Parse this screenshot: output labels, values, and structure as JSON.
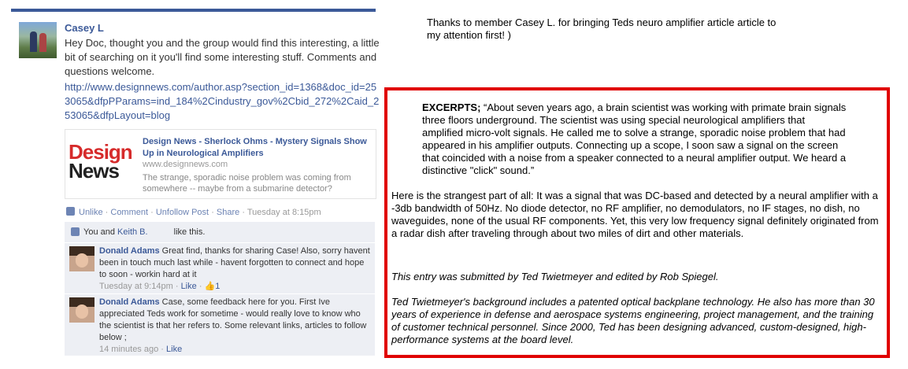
{
  "facebook_post": {
    "poster_name": "Casey L",
    "text": "Hey Doc, thought you and the group would find this interesting, a little bit of searching on it you'll find some interesting stuff. Comments and questions welcome.",
    "link_url": "http://www.designnews.com/author.asp?section_id=1368&doc_id=253065&dfpPParams=ind_184%2Cindustry_gov%2Cbid_272%2Caid_253065&dfpLayout=blog",
    "link_card": {
      "logo_line1": "Design",
      "logo_line2": "News",
      "title": "Design News - Sherlock Ohms - Mystery Signals Show Up in Neurological Amplifiers",
      "domain": "www.designnews.com",
      "description": "The strange, sporadic noise problem was coming from somewhere -- maybe from a submarine detector?"
    },
    "actions": {
      "unlike": "Unlike",
      "comment": "Comment",
      "unfollow": "Unfollow Post",
      "share": "Share",
      "separator": "·",
      "timestamp": "Tuesday at 8:15pm"
    },
    "likes": {
      "prefix": "You and",
      "liker": "Keith B.",
      "suffix": "like this."
    },
    "comments": [
      {
        "name": "Donald Adams",
        "text": "Great find, thanks for sharing Case! Also, sorry havent been in touch much last while - havent forgotten to connect and hope to soon - workin hard at it",
        "time": "Tuesday at 9:14pm",
        "like_label": "Like",
        "like_count": "1"
      },
      {
        "name": "Donald Adams",
        "text": "Case, some feedback here for you. First Ive appreciated Teds work for sometime - would really love to know who the scientist is that her refers to. Some relevant links, articles to follow below ;",
        "time": "14 minutes ago",
        "like_label": "Like"
      }
    ]
  },
  "thanks_note": "Thanks to member Casey L. for bringing Teds neuro amplifier article article to my attention first! )",
  "excerpt": {
    "label": "EXCERPTS; ",
    "intro": "“About seven years ago, a brain scientist was working with primate brain signals three floors underground. The scientist was using special neurological amplifiers that amplified micro-volt signals. He called me to solve a strange, sporadic noise problem that had appeared in his amplifier outputs.  Connecting up a scope, I soon saw a signal on the screen that coincided with a noise from a speaker connected to a neural amplifier output. We heard a distinctive \"click\" sound.”",
    "paragraph2": "Here is the strangest part of all: It was a signal that was DC-based and detected by a neural amplifier with a -3db bandwidth of 50Hz. No diode detector, no RF amplifier, no demodulators, no IF stages, no dish, no waveguides, none of the usual RF components. Yet, this very low frequency signal definitely originated from a radar dish after traveling through about two miles of dirt and other materials.",
    "credit": "This entry was submitted by Ted Twietmeyer and edited by Rob Spiegel.",
    "bio": "Ted Twietmeyer's background includes a patented optical backplane technology. He also has more than 30 years of experience in defense and aerospace systems engineering, project management, and the training of customer technical personnel. Since 2000, Ted has been designing advanced, custom-designed, high-performance systems at the board level."
  },
  "colors": {
    "facebook_blue": "#3b5998",
    "comment_bg": "#edeff4",
    "excerpt_border": "#e00000"
  }
}
